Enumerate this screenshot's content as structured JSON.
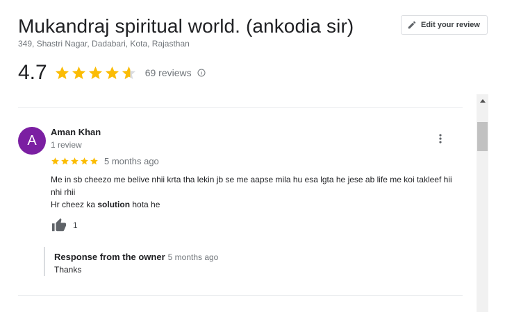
{
  "place": {
    "name": "Mukandraj spiritual world. (ankodia sir)",
    "address": "349, Shastri Nagar, Dadabari, Kota, Rajasthan"
  },
  "edit_button": {
    "label": "Edit your review"
  },
  "rating": {
    "value": "4.7",
    "stars": 4.7,
    "reviews_label": "69 reviews"
  },
  "review": {
    "avatar_initial": "A",
    "avatar_color": "#7b1fa2",
    "author": "Aman Khan",
    "author_meta": "1 review",
    "stars": 5,
    "time": "5 months ago",
    "text_line1": "Me in sb cheezo me belive nhii krta tha lekin jb se me aapse mila hu esa lgta he jese ab life me koi takleef hii nhi rhii",
    "text_line2_a": "Hr cheez ka ",
    "text_line2_bold": "solution",
    "text_line2_b": " hota he",
    "likes": "1",
    "owner_response": {
      "title": "Response from the owner",
      "time": "5 months ago",
      "text": "Thanks"
    }
  },
  "colors": {
    "star": "#fbbc04",
    "star_empty": "#dadce0"
  },
  "icons": [
    "pencil-icon",
    "star-icon",
    "info-icon",
    "more-vert-icon",
    "thumb-up-icon",
    "chevron-up-icon"
  ]
}
